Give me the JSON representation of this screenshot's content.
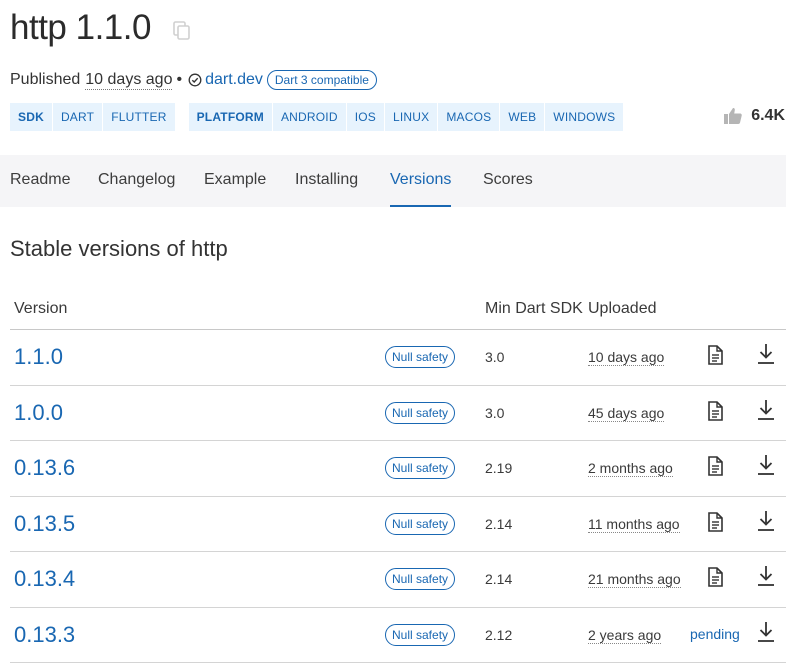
{
  "package": {
    "title": "http 1.1.0",
    "published_prefix": "Published",
    "published_age": "10 days ago",
    "bullet": "•",
    "publisher": "dart.dev",
    "compat_badge": "Dart 3 compatible"
  },
  "tags": {
    "sdk_group": [
      "SDK",
      "DART",
      "FLUTTER"
    ],
    "platform_group": [
      "PLATFORM",
      "ANDROID",
      "IOS",
      "LINUX",
      "MACOS",
      "WEB",
      "WINDOWS"
    ]
  },
  "likes": {
    "count": "6.4K",
    "icon": "thumbs-up-icon"
  },
  "tabs": [
    {
      "label": "Readme"
    },
    {
      "label": "Changelog"
    },
    {
      "label": "Example"
    },
    {
      "label": "Installing"
    },
    {
      "label": "Versions",
      "active": true
    },
    {
      "label": "Scores"
    }
  ],
  "section_title": "Stable versions of http",
  "table": {
    "headers": {
      "version": "Version",
      "min_sdk": "Min Dart SDK",
      "uploaded": "Uploaded"
    },
    "rows": [
      {
        "version": "1.1.0",
        "badge": "Null safety",
        "sdk": "3.0",
        "uploaded": "10 days ago",
        "docs": "doc-icon"
      },
      {
        "version": "1.0.0",
        "badge": "Null safety",
        "sdk": "3.0",
        "uploaded": "45 days ago",
        "docs": "doc-icon"
      },
      {
        "version": "0.13.6",
        "badge": "Null safety",
        "sdk": "2.19",
        "uploaded": "2 months ago",
        "docs": "doc-icon"
      },
      {
        "version": "0.13.5",
        "badge": "Null safety",
        "sdk": "2.14",
        "uploaded": "11 months ago",
        "docs": "doc-icon"
      },
      {
        "version": "0.13.4",
        "badge": "Null safety",
        "sdk": "2.14",
        "uploaded": "21 months ago",
        "docs": "doc-icon"
      },
      {
        "version": "0.13.3",
        "badge": "Null safety",
        "sdk": "2.12",
        "uploaded": "2 years ago",
        "docs": "pending"
      }
    ]
  },
  "colors": {
    "accent": "#1967b2",
    "tag_bg": "#e7f3fd",
    "tabs_bg": "#f5f5f7"
  }
}
